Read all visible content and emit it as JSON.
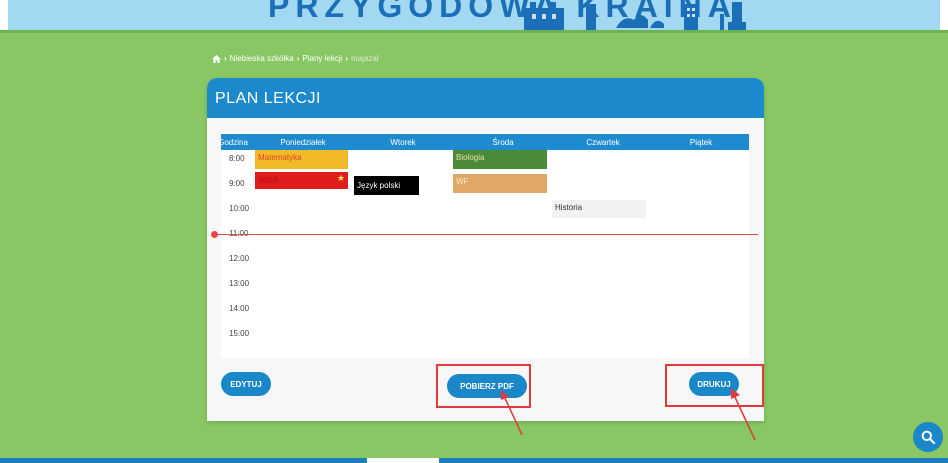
{
  "banner": {
    "title": "PRZYGODOWA KRAINA"
  },
  "breadcrumb": {
    "home_icon": "home-icon",
    "items": [
      "Niebieska szkółka",
      "Plany lekcji",
      "majazal"
    ]
  },
  "card": {
    "title": "PLAN LEKCJI"
  },
  "timetable": {
    "headers": [
      "Godzina",
      "Poniedziałek",
      "Wtorek",
      "Środa",
      "Czwartek",
      "Piątek"
    ],
    "hours": [
      "8:00",
      "9:00",
      "10:00",
      "11:00",
      "12:00",
      "13:00",
      "14:00",
      "15:00"
    ],
    "lessons": [
      {
        "name": "Matematyka",
        "day": "Poniedziałek",
        "color": "#f2b928",
        "text_color": "#d9472b"
      },
      {
        "name": "Język",
        "day": "Poniedziałek",
        "color": "#e01b1b",
        "text_color": "#b01010",
        "starred": true
      },
      {
        "name": "Język polski",
        "day": "Wtorek",
        "color": "#000000",
        "text_color": "#ffffff"
      },
      {
        "name": "Biologia",
        "day": "Środa",
        "color": "#4a8b3a",
        "text_color": "#e8e2a0"
      },
      {
        "name": "WF",
        "day": "Środa",
        "color": "#e0a866",
        "text_color": "#f7e9d0"
      },
      {
        "name": "Historia",
        "day": "Czwartek",
        "color": "#f2f2f2",
        "text_color": "#333333"
      }
    ]
  },
  "buttons": {
    "edit": "EDYTUJ",
    "pdf": "POBIERZ PDF",
    "print": "DRUKUJ"
  },
  "colors": {
    "accent": "#1a87c9",
    "background": "#88c763",
    "highlight": "#e03a3a"
  }
}
